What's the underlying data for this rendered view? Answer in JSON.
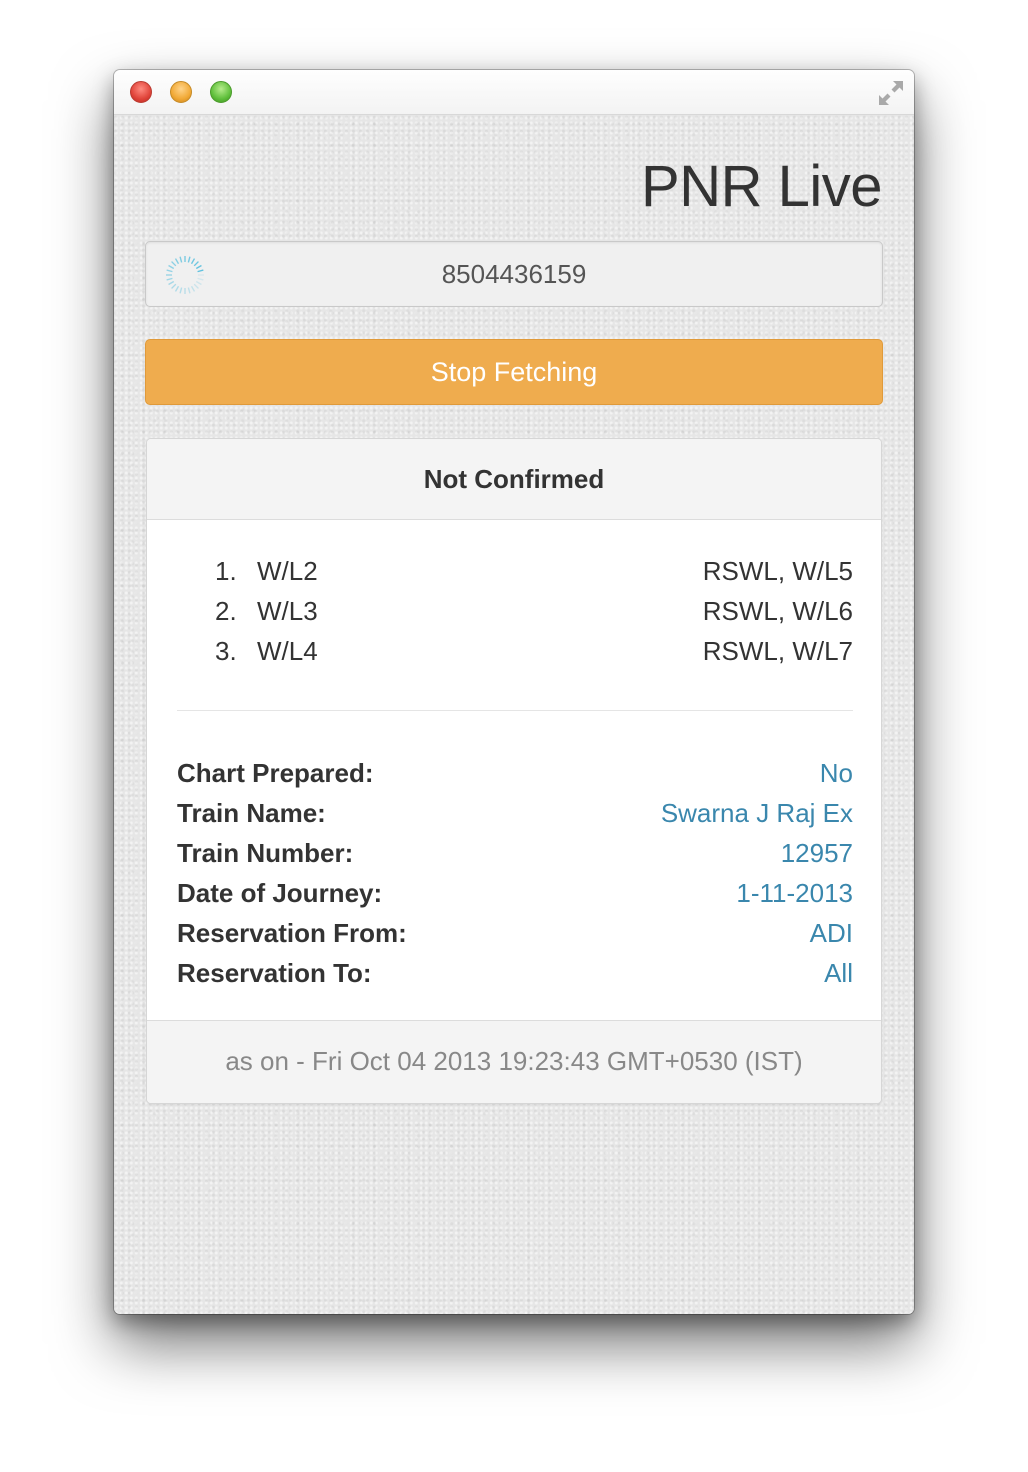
{
  "app": {
    "title": "PNR Live"
  },
  "pnr_input": {
    "value": "8504436159"
  },
  "stop_button": {
    "label": "Stop Fetching"
  },
  "status": {
    "header": "Not Confirmed",
    "passengers": [
      {
        "number": "1.",
        "booking_status": "W/L2",
        "current_status": "RSWL, W/L5"
      },
      {
        "number": "2.",
        "booking_status": "W/L3",
        "current_status": "RSWL, W/L6"
      },
      {
        "number": "3.",
        "booking_status": "W/L4",
        "current_status": "RSWL, W/L7"
      }
    ],
    "details": [
      {
        "label": "Chart Prepared:",
        "value": "No"
      },
      {
        "label": "Train Name:",
        "value": "Swarna J Raj Ex"
      },
      {
        "label": "Train Number:",
        "value": "12957"
      },
      {
        "label": "Date of Journey:",
        "value": "1-11-2013"
      },
      {
        "label": "Reservation From:",
        "value": "ADI"
      },
      {
        "label": "Reservation To:",
        "value": "All"
      }
    ],
    "footer": "as on - Fri Oct 04 2013 19:23:43 GMT+0530 (IST)"
  },
  "colors": {
    "accent_button": "#efac4e",
    "value_text": "#3a87ad",
    "close_light": "#e0443a",
    "minimize_light": "#f1a936",
    "zoom_light": "#5fbf3b"
  },
  "icons": {
    "spinner": "loading-spinner-icon",
    "fullscreen": "fullscreen-icon"
  }
}
